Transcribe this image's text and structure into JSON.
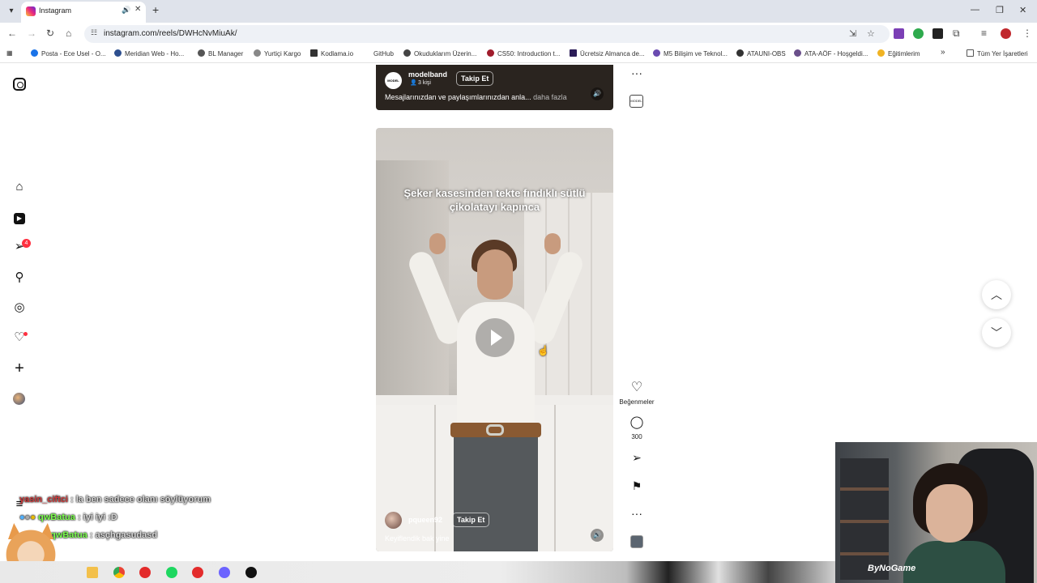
{
  "browser": {
    "tab_title": "Instagram",
    "new_tab": "+",
    "url": "instagram.com/reels/DWHcNvMiuAk/",
    "bookmarks": [
      "Posta - Ece Usel - O...",
      "Meridian Web - Ho...",
      "BL Manager",
      "Yurtiçi Kargo",
      "Kodlama.io",
      "GitHub",
      "Okuduklarım Üzerin...",
      "CS50: Introduction t...",
      "Ücretsiz Almanca de...",
      "M5 Bilişim ve Teknol...",
      "ATAUNI-OBS",
      "ATA-AÖF - Hoşgeldi...",
      "Eğitimlerim"
    ],
    "all_bookmarks": "Tüm Yer İşaretleri",
    "bookmark_more": "»"
  },
  "sidebar": {
    "notification_count": "4"
  },
  "reel_top": {
    "avatar_text": "MODEL",
    "username": "modelband",
    "sub": "3 kişi",
    "follow_label": "Takip Et",
    "caption": "Mesajlarınızdan ve paylaşımlarınızdan anla... ",
    "more_label": "daha fazla",
    "thumb_text": "MODEL"
  },
  "reel_main": {
    "overlay_text": "Şeker kasesinden tekte fındıklı sütlü çikolatayı kapınca",
    "username": "pqueen92",
    "follow_label": "Takip Et",
    "caption": "Keyiflendik bak yine"
  },
  "actions": {
    "likes_label": "Beğenmeler",
    "comments_count": "300",
    "more": "···"
  },
  "chat": [
    {
      "user": "yasin_ciftci",
      "message": ": la ben sadece olanı söylüyorum"
    },
    {
      "user": "qwBatua",
      "message": ": iyi iyi :D"
    },
    {
      "user": "qwBatua",
      "message": ": asçhgasudasd"
    }
  ],
  "webcam": {
    "logo_text": "ByNoGame"
  },
  "colors": {
    "accent_red": "#ff3040",
    "chat_red": "#d03b3b",
    "chat_green": "#7cff4f"
  }
}
